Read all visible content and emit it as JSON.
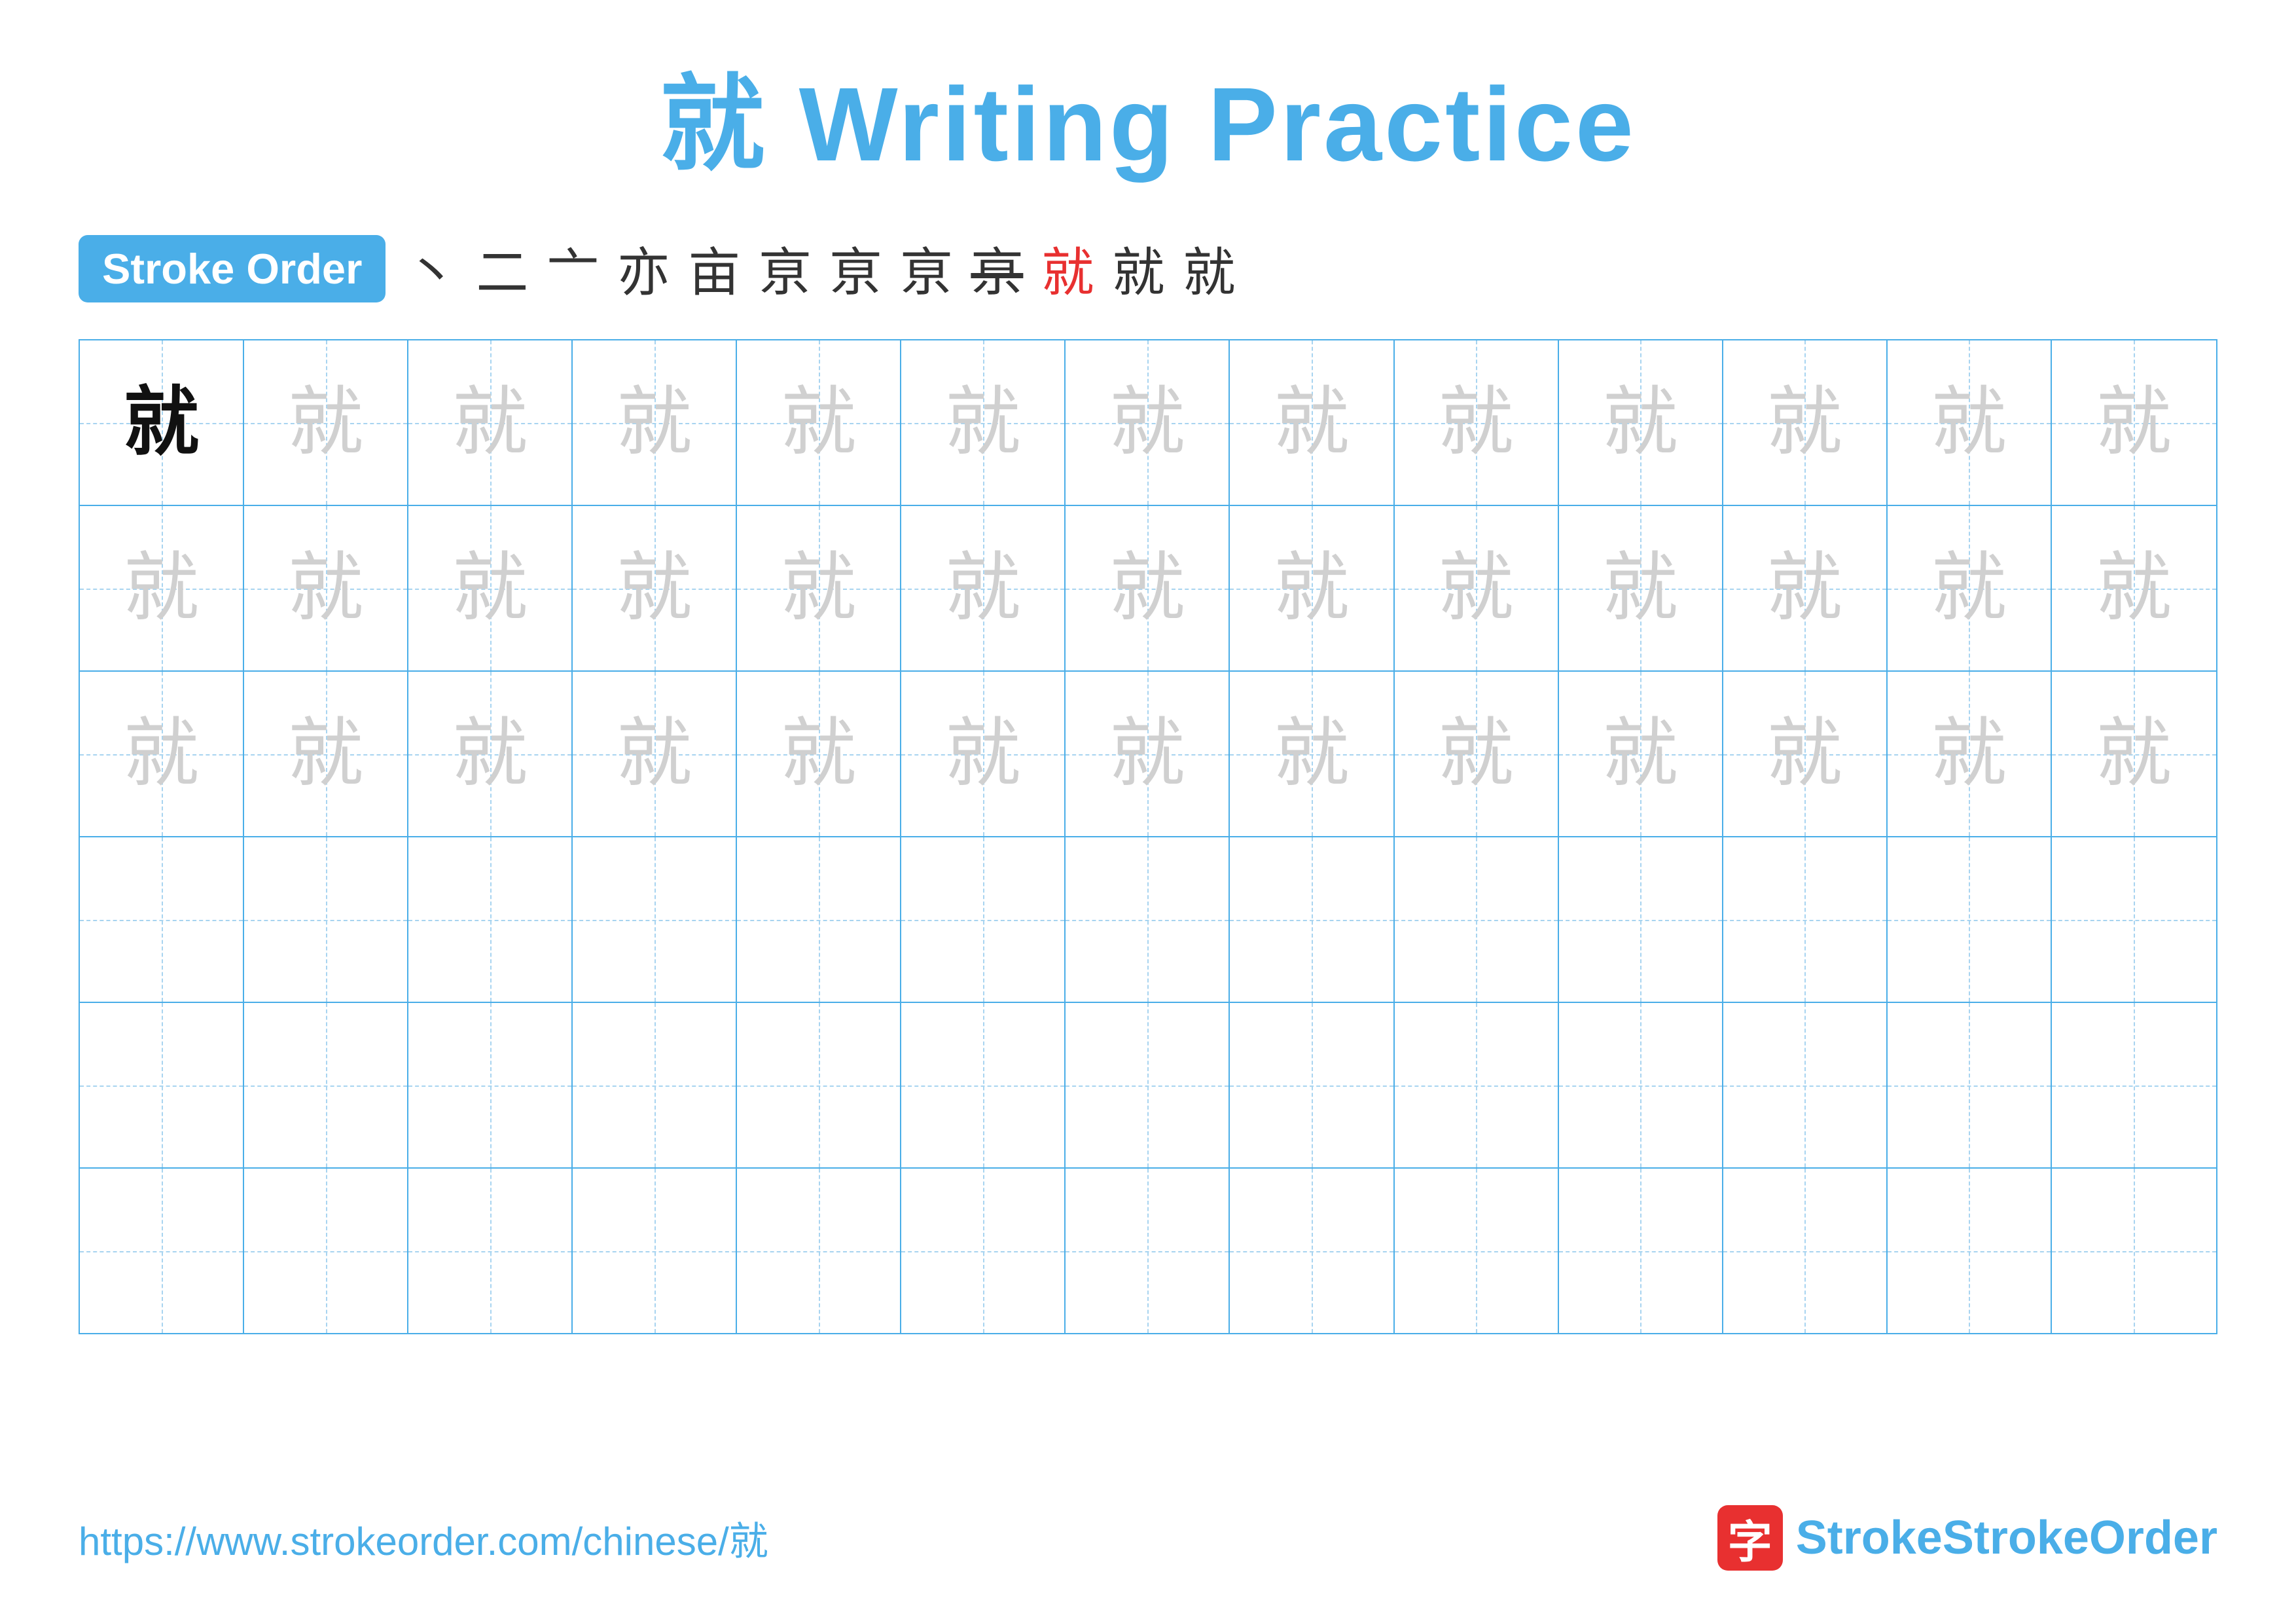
{
  "title": "就 Writing Practice",
  "stroke_order": {
    "badge_label": "Stroke Order",
    "strokes": [
      "丶",
      "二",
      "亠",
      "亦",
      "亩",
      "亰",
      "亰",
      "亰",
      "亰",
      "就",
      "就",
      "就"
    ]
  },
  "grid": {
    "rows": 6,
    "cols": 13,
    "char": "就",
    "row_types": [
      "dark-first",
      "light",
      "light",
      "empty",
      "empty",
      "empty"
    ]
  },
  "footer": {
    "url": "https://www.strokeorder.com/chinese/就",
    "logo_icon": "字",
    "logo_text": "StrokeOrder"
  }
}
